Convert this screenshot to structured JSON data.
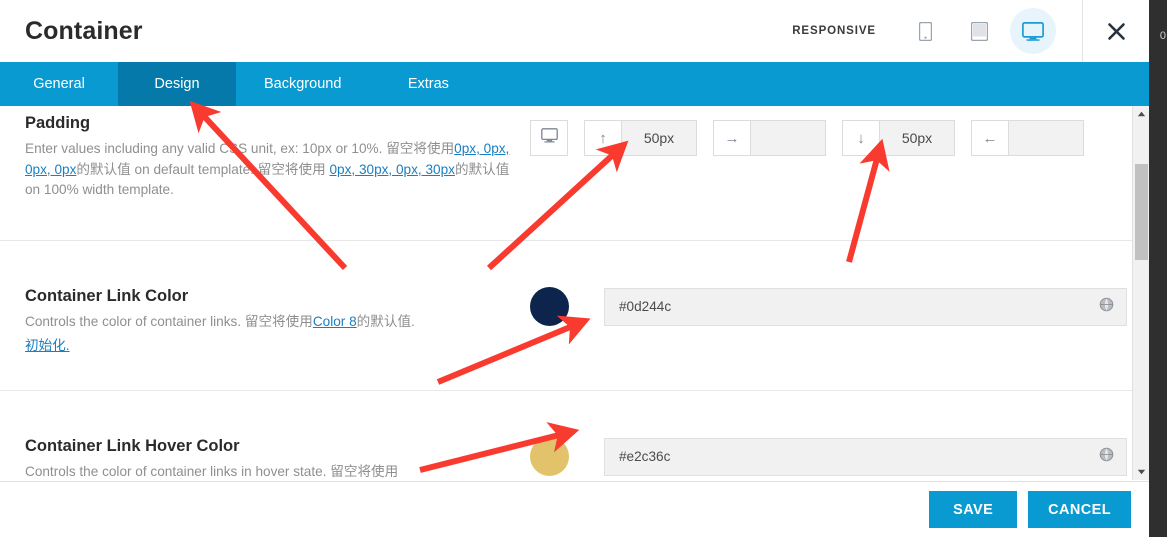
{
  "header": {
    "title": "Container",
    "responsive_label": "RESPONSIVE",
    "devices": [
      {
        "name": "mobile",
        "icon": "mobile-icon",
        "active": false
      },
      {
        "name": "tablet",
        "icon": "tablet-icon",
        "active": false
      },
      {
        "name": "desktop",
        "icon": "desktop-icon",
        "active": true
      }
    ],
    "close_icon": "close-icon"
  },
  "tabs": [
    {
      "label": "General",
      "active": false
    },
    {
      "label": "Design",
      "active": true
    },
    {
      "label": "Background",
      "active": false
    },
    {
      "label": "Extras",
      "active": false
    }
  ],
  "fields": {
    "padding": {
      "title": "Padding",
      "desc_1": "Enter values including any valid CSS unit, ex: 10px or 10%. 留空将使用",
      "desc_link_1": "0px, 0px, 0px, 0px",
      "desc_2": "的默认值 on default template. 留空将使用",
      "desc_link_2": "0px, 30px, 0px, 30px",
      "desc_3": "的默认值 on 100% width template.",
      "device_icon": "desktop-icon",
      "inputs": [
        {
          "name": "padding-top",
          "arrow": "↑",
          "value": "50px",
          "placeholder": ""
        },
        {
          "name": "padding-right",
          "arrow": "→",
          "value": "",
          "placeholder": ""
        },
        {
          "name": "padding-bottom",
          "arrow": "↓",
          "value": "50px",
          "placeholder": ""
        },
        {
          "name": "padding-left",
          "arrow": "←",
          "value": "",
          "placeholder": ""
        }
      ]
    },
    "link_color": {
      "title": "Container Link Color",
      "desc_1": "Controls the color of container links. 留空将使用",
      "desc_link": "Color 8",
      "desc_2": "的默认值.",
      "reset_label": "初始化.",
      "swatch_color": "#0d244c",
      "value": "#0d244c",
      "globe_icon": "globe-icon"
    },
    "link_hover_color": {
      "title": "Container Link Hover Color",
      "desc_1": "Controls the color of container links in hover state. 留空将使用",
      "swatch_color": "#e2c36c",
      "value": "#e2c36c",
      "globe_icon": "globe-icon"
    }
  },
  "footer": {
    "save_label": "SAVE",
    "cancel_label": "CANCEL"
  },
  "scrollbar": {
    "up_icon": "scroll-up-arrow-icon",
    "down_icon": "scroll-down-arrow-icon"
  },
  "theme": {
    "accent_blue": "#0a9ad2",
    "active_tab_blue": "#0679ab",
    "annotation_red": "#f93a2f"
  }
}
